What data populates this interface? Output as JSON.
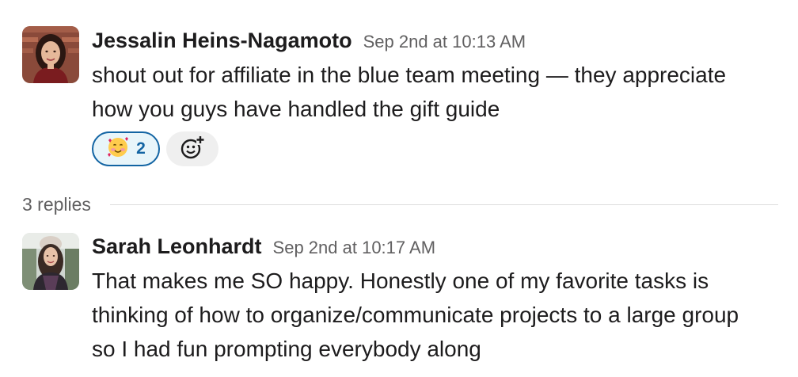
{
  "messages": [
    {
      "author": "Jessalin Heins-Nagamoto",
      "timestamp": "Sep 2nd at 10:13 AM",
      "lines": [
        "shout out for affiliate in the blue team meeting — they appreciate",
        "how you guys have handled the gift guide"
      ],
      "avatar_icon": "person-photo-avatar",
      "reactions": [
        {
          "emoji_icon": "smiling-face-with-hearts-emoji",
          "count": "2",
          "reacted_by_me": true
        }
      ],
      "add_reaction_icon": "add-emoji-icon"
    },
    {
      "author": "Sarah Leonhardt",
      "timestamp": "Sep 2nd at 10:17 AM",
      "lines": [
        "That makes me SO happy. Honestly one of my favorite tasks is",
        "thinking of how to organize/communicate projects to a large group",
        "so I had fun prompting everybody along"
      ],
      "avatar_icon": "person-photo-avatar"
    }
  ],
  "thread": {
    "replies_label": "3 replies"
  },
  "colors": {
    "accent": "#1264a3",
    "reaction_bg": "#e8f5fa",
    "muted_text": "#616061",
    "text": "#1d1c1d"
  }
}
